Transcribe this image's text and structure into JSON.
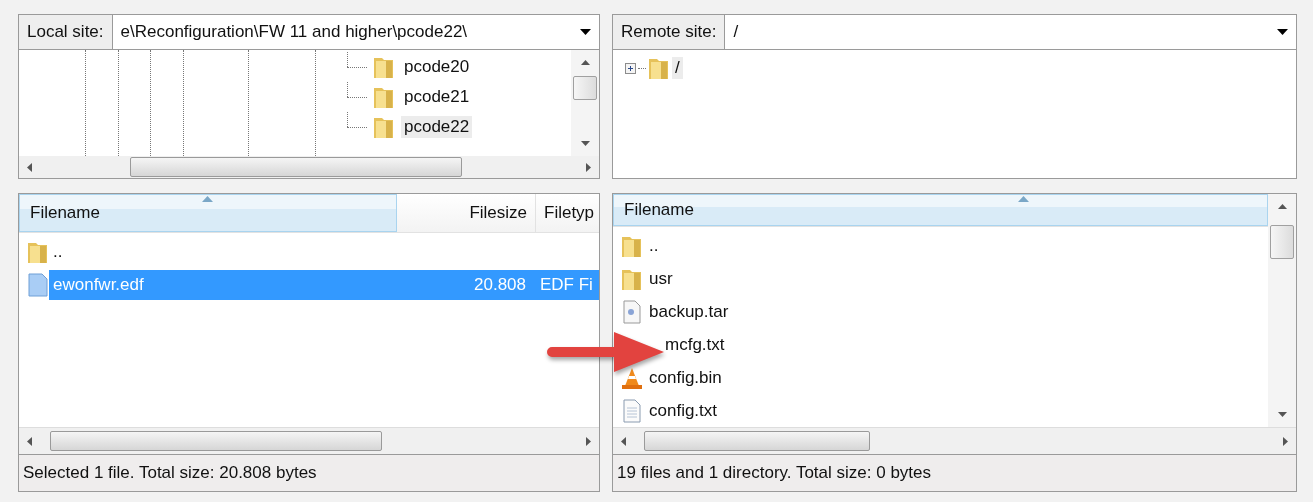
{
  "local_site": {
    "label": "Local site:",
    "path": "e\\Reconfiguration\\FW 11 and higher\\pcode22\\"
  },
  "local_tree": [
    {
      "name": "pcode20",
      "selected": false
    },
    {
      "name": "pcode21",
      "selected": false
    },
    {
      "name": "pcode22",
      "selected": true
    }
  ],
  "remote_site": {
    "label": "Remote site:",
    "path": "/"
  },
  "remote_tree": [
    {
      "name": "/",
      "expanded": false,
      "selected": true
    }
  ],
  "local_files": {
    "columns": [
      "Filename",
      "Filesize",
      "Filetyp"
    ],
    "rows": [
      {
        "kind": "folder",
        "name": "..",
        "selected": false
      },
      {
        "kind": "file",
        "name": "ewonfwr.edf",
        "size": "20.808",
        "type": "EDF Fi",
        "selected": true
      }
    ]
  },
  "remote_files": {
    "columns": [
      "Filename"
    ],
    "rows": [
      {
        "kind": "folder",
        "name": ".."
      },
      {
        "kind": "folder",
        "name": "usr"
      },
      {
        "kind": "archive",
        "name": "backup.tar"
      },
      {
        "kind": "covered",
        "name": "mcfg.txt"
      },
      {
        "kind": "cone",
        "name": "config.bin"
      },
      {
        "kind": "text",
        "name": "config.txt"
      }
    ]
  },
  "local_status": "Selected 1 file. Total size: 20.808 bytes",
  "remote_status": "19 files and 1 directory. Total size: 0 bytes"
}
